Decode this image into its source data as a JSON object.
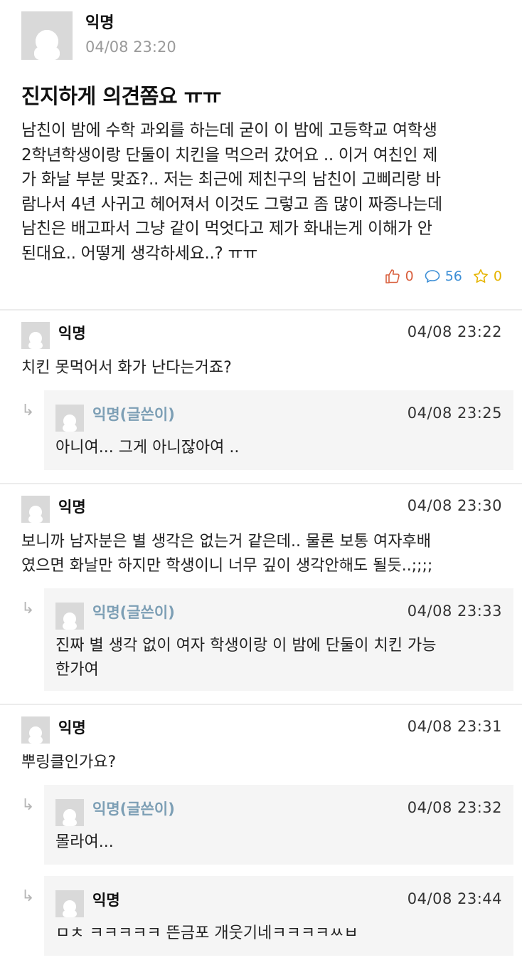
{
  "post": {
    "author": "익명",
    "time": "04/08 23:20",
    "title": "진지하게 의견쫌요 ㅠㅠ",
    "body_lines": [
      "남친이 밤에 수학 과외를 하는데 굳이 이 밤에 고등학교 여학생",
      "2학년학생이랑 단둘이 치킨을 먹으러 갔어요 .. 이거 여친인 제",
      "가 화날 부분 맞죠?.. 저는 최근에 제친구의 남친이 고삐리랑 바",
      "람나서 4년 사귀고 헤어져서 이것도 그렇고 좀 많이 짜증나는데",
      "남친은 배고파서 그냥 같이 먹엇다고 제가 화내는게 이해가 안",
      "된대요.. 어떻게 생각하세요..? ㅠㅠ"
    ],
    "stats": {
      "likes": "0",
      "comments": "56",
      "scraps": "0"
    }
  },
  "comments": [
    {
      "author": "익명",
      "time": "04/08 23:22",
      "lines": [
        "치킨 못먹어서 화가 난다는거죠?"
      ],
      "replies": [
        {
          "author": "익명(글쓴이)",
          "time": "04/08 23:25",
          "lines": [
            "아니여... 그게 아니잖아여 .."
          ]
        }
      ]
    },
    {
      "author": "익명",
      "time": "04/08 23:30",
      "lines": [
        "보니까 남자분은 별 생각은 없는거 같은데.. 물론 보통 여자후배",
        "였으면 화날만 하지만 학생이니 너무 깊이 생각안해도 될듯..;;;;"
      ],
      "replies": [
        {
          "author": "익명(글쓴이)",
          "time": "04/08 23:33",
          "lines": [
            "진짜 별 생각 없이 여자 학생이랑 이 밤에 단둘이 치킨 가능",
            "한가여"
          ]
        }
      ]
    },
    {
      "author": "익명",
      "time": "04/08 23:31",
      "lines": [
        "뿌링클인가요?"
      ],
      "replies": [
        {
          "author": "익명(글쓴이)",
          "time": "04/08 23:32",
          "lines": [
            "몰라여..."
          ]
        },
        {
          "author": "익명",
          "time": "04/08 23:44",
          "lines": [
            "ㅁㅊ ㅋㅋㅋㅋㅋ 뜬금포 개웃기네ㅋㅋㅋㅋㅆㅂ"
          ]
        }
      ]
    }
  ],
  "reply_arrow": "↳",
  "colors": {
    "op_author": "#7d9fb5",
    "like": "#d9603f",
    "comment": "#3d8fd6",
    "scrap": "#e6b400",
    "reply_bg": "#f5f5f5"
  },
  "icons": {
    "avatar": "default-user-icon",
    "like": "thumbs-up-icon",
    "comment": "speech-bubble-icon",
    "scrap": "star-icon"
  }
}
